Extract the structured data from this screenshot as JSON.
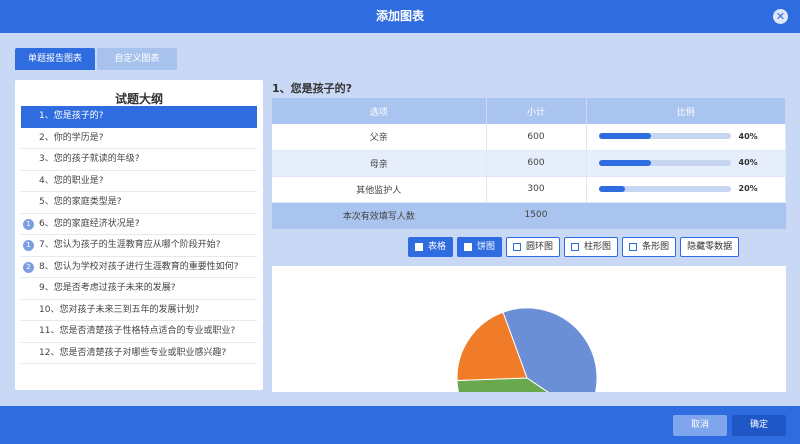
{
  "dialog": {
    "title": "添加图表",
    "close_icon": "close-icon"
  },
  "tabs": [
    {
      "label": "单题报告图表",
      "active": true
    },
    {
      "label": "自定义图表",
      "active": false
    }
  ],
  "outline": {
    "title": "试题大纲",
    "items": [
      {
        "label": "1、您是孩子的?",
        "badge": ""
      },
      {
        "label": "2、你的学历是?",
        "badge": ""
      },
      {
        "label": "3、您的孩子就读的年级?",
        "badge": ""
      },
      {
        "label": "4、您的职业是?",
        "badge": ""
      },
      {
        "label": "5、您的家庭类型是?",
        "badge": ""
      },
      {
        "label": "6、您的家庭经济状况是?",
        "badge": "1"
      },
      {
        "label": "7、您认为孩子的生涯教育应从哪个阶段开始?",
        "badge": "1"
      },
      {
        "label": "8、您认为学校对孩子进行生涯教育的重要性如何?",
        "badge": "2"
      },
      {
        "label": "9、您是否考虑过孩子未来的发展?",
        "badge": ""
      },
      {
        "label": "10、您对孩子未来三到五年的发展计划?",
        "badge": ""
      },
      {
        "label": "11、您是否清楚孩子性格特点适合的专业或职业?",
        "badge": ""
      },
      {
        "label": "12、您是否清楚孩子对哪些专业或职业感兴趣?",
        "badge": ""
      }
    ]
  },
  "question": {
    "title": "1、您是孩子的?",
    "headers": {
      "option": "选项",
      "count": "小计",
      "ratio": "比例"
    },
    "rows": [
      {
        "option": "父亲",
        "count": "600",
        "pct_label": "40%",
        "fraction": 0.4
      },
      {
        "option": "母亲",
        "count": "600",
        "pct_label": "40%",
        "fraction": 0.4
      },
      {
        "option": "其他监护人",
        "count": "300",
        "pct_label": "20%",
        "fraction": 0.2
      }
    ],
    "total": {
      "label": "本次有效填写人数",
      "count": "1500"
    }
  },
  "chart_buttons": [
    {
      "label": "表格",
      "on": true
    },
    {
      "label": "饼图",
      "on": true
    },
    {
      "label": "圆环图",
      "on": false
    },
    {
      "label": "柱形图",
      "on": false
    },
    {
      "label": "条形图",
      "on": false
    },
    {
      "label": "隐藏零数据",
      "on": false,
      "plain": true
    }
  ],
  "chart_data": {
    "type": "pie",
    "categories": [
      "父亲",
      "母亲",
      "其他监护人"
    ],
    "values": [
      600,
      600,
      300
    ],
    "colors": [
      "#6a8fd6",
      "#6aa84f",
      "#f07c2a"
    ]
  },
  "footer": {
    "cancel_label": "取消",
    "ok_label": "确定"
  },
  "colors": {
    "primary": "#2f6ce0",
    "header": "#aac4f0"
  }
}
